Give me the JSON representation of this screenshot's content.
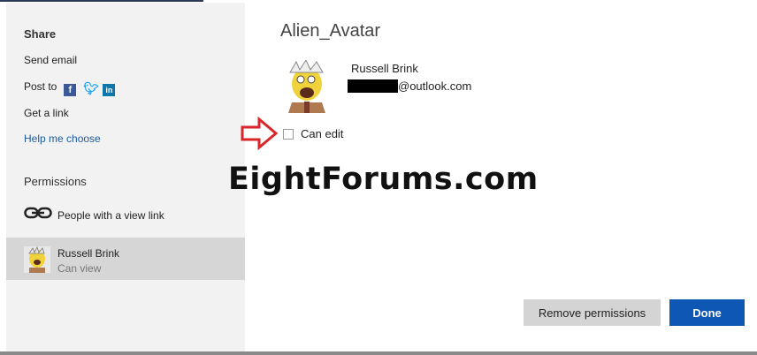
{
  "sidebar": {
    "share_heading": "Share",
    "send_email": "Send email",
    "post_to": "Post to",
    "get_link": "Get a link",
    "help_link": "Help me choose",
    "permissions_heading": "Permissions",
    "view_link_label": "People with a view link",
    "permission_entry": {
      "name": "Russell Brink",
      "role": "Can view"
    },
    "social_icons": [
      "facebook-icon",
      "twitter-icon",
      "linkedin-icon"
    ]
  },
  "main": {
    "title": "Alien_Avatar",
    "user": {
      "name": "Russell Brink",
      "email_suffix": "@outlook.com"
    },
    "can_edit_label": "Can edit",
    "can_edit_checked": false
  },
  "watermark": "EightForums.com",
  "buttons": {
    "remove": "Remove permissions",
    "done": "Done"
  },
  "colors": {
    "done_button": "#0f57b5",
    "help_link": "#1d5a9e",
    "arrow": "#d9262b",
    "selected_row": "#d6d6d6"
  }
}
